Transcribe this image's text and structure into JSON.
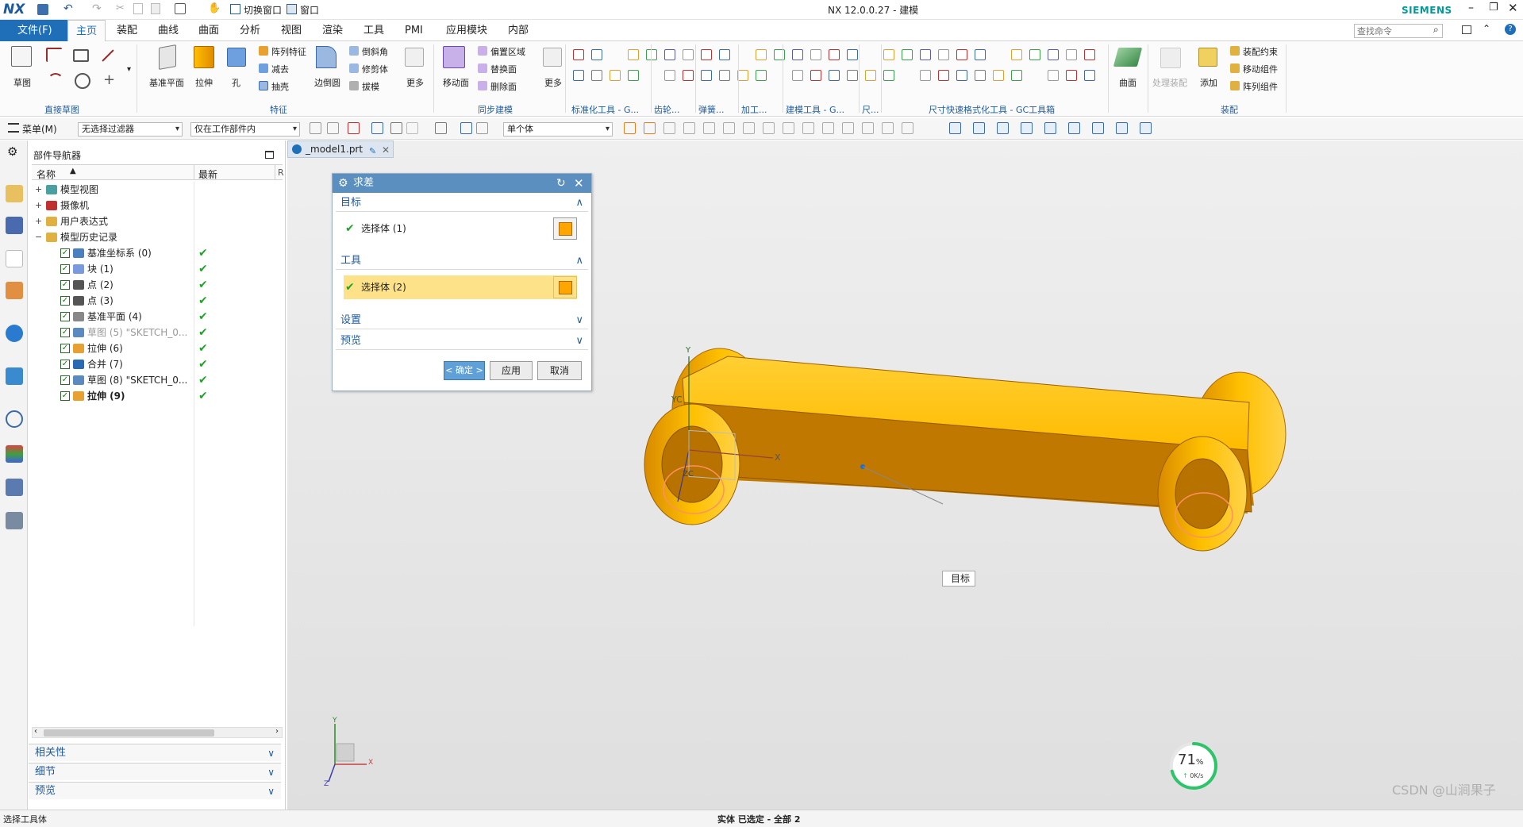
{
  "app": {
    "logo": "NX",
    "title": "NX 12.0.0.27 - 建模",
    "brand": "SIEMENS",
    "search_placeholder": "查找命令",
    "quick_switch": "切换窗口",
    "quick_window": "窗口"
  },
  "menu": {
    "file": "文件(F)",
    "tabs": [
      "主页",
      "装配",
      "曲线",
      "曲面",
      "分析",
      "视图",
      "渲染",
      "工具",
      "PMI",
      "应用模块",
      "内部"
    ]
  },
  "ribbon": {
    "groups": [
      "直接草图",
      "特征",
      "同步建模",
      "标准化工具 - G...",
      "齿轮...",
      "弹簧...",
      "加工...",
      "建模工具 - G...",
      "尺...",
      "尺寸快速格式化工具 - GC工具箱",
      "装配"
    ],
    "sketch": "草图",
    "datum_plane": "基准平面",
    "extrude": "拉伸",
    "hole": "孔",
    "pattern_feature": "阵列特征",
    "subtract": "减去",
    "shell": "抽壳",
    "edge_blend": "边倒圆",
    "chamfer": "倒斜角",
    "trim_body": "修剪体",
    "draft": "拔模",
    "more1": "更多",
    "move_face": "移动面",
    "offset_region": "偏置区域",
    "replace_face": "替换面",
    "delete_face": "删除面",
    "more2": "更多",
    "surface": "曲面",
    "process_assembly": "处理装配",
    "add": "添加",
    "assembly_constraint": "装配约束",
    "move_component": "移动组件",
    "pattern_component": "阵列组件"
  },
  "toolbar2": {
    "menu": "菜单(M)",
    "filter": "无选择过滤器",
    "scope": "仅在工作部件内",
    "body_mode": "单个体"
  },
  "navigator": {
    "title": "部件导航器",
    "col_name": "名称",
    "col_latest": "最新",
    "col_extra": "R",
    "top_nodes": [
      "模型视图",
      "摄像机",
      "用户表达式",
      "模型历史记录"
    ],
    "features": [
      {
        "label": "基准坐标系 (0)",
        "latest": true,
        "dim": false,
        "bold": false
      },
      {
        "label": "块 (1)",
        "latest": true,
        "dim": false,
        "bold": false
      },
      {
        "label": "点 (2)",
        "latest": true,
        "dim": false,
        "bold": false
      },
      {
        "label": "点 (3)",
        "latest": true,
        "dim": false,
        "bold": false
      },
      {
        "label": "基准平面 (4)",
        "latest": true,
        "dim": false,
        "bold": false
      },
      {
        "label": "草图 (5) \"SKETCH_0...",
        "latest": true,
        "dim": true,
        "bold": false
      },
      {
        "label": "拉伸 (6)",
        "latest": true,
        "dim": false,
        "bold": false
      },
      {
        "label": "合并 (7)",
        "latest": true,
        "dim": false,
        "bold": false
      },
      {
        "label": "草图 (8) \"SKETCH_0...",
        "latest": true,
        "dim": false,
        "bold": false
      },
      {
        "label": "拉伸 (9)",
        "latest": true,
        "dim": false,
        "bold": true
      }
    ],
    "sections": [
      "相关性",
      "细节",
      "预览"
    ]
  },
  "viewport": {
    "tab_label": "_model1.prt",
    "target_tag": "目标",
    "axis_x": "X",
    "axis_y": "Y",
    "axis_yc": "YC",
    "axis_zc": "ZC",
    "mini_x": "X",
    "mini_y": "Y",
    "mini_z": "Z",
    "perf_percent": "71",
    "perf_unit": "%",
    "perf_rate": "0K/s",
    "watermark": "CSDN @山涧果子"
  },
  "dialog": {
    "title": "求差",
    "target_section": "目标",
    "target_select": "选择体 (1)",
    "tool_section": "工具",
    "tool_select": "选择体 (2)",
    "settings_section": "设置",
    "preview_section": "预览",
    "ok": "< 确定 >",
    "apply": "应用",
    "cancel": "取消"
  },
  "status": {
    "left": "选择工具体",
    "center": "实体 已选定 - 全部 2"
  },
  "colors": {
    "accent": "#1e6fb8",
    "dialog_title": "#5a8fc0",
    "highlight": "#fde28a",
    "part_top": "#ffc000",
    "part_side": "#c07a00"
  }
}
